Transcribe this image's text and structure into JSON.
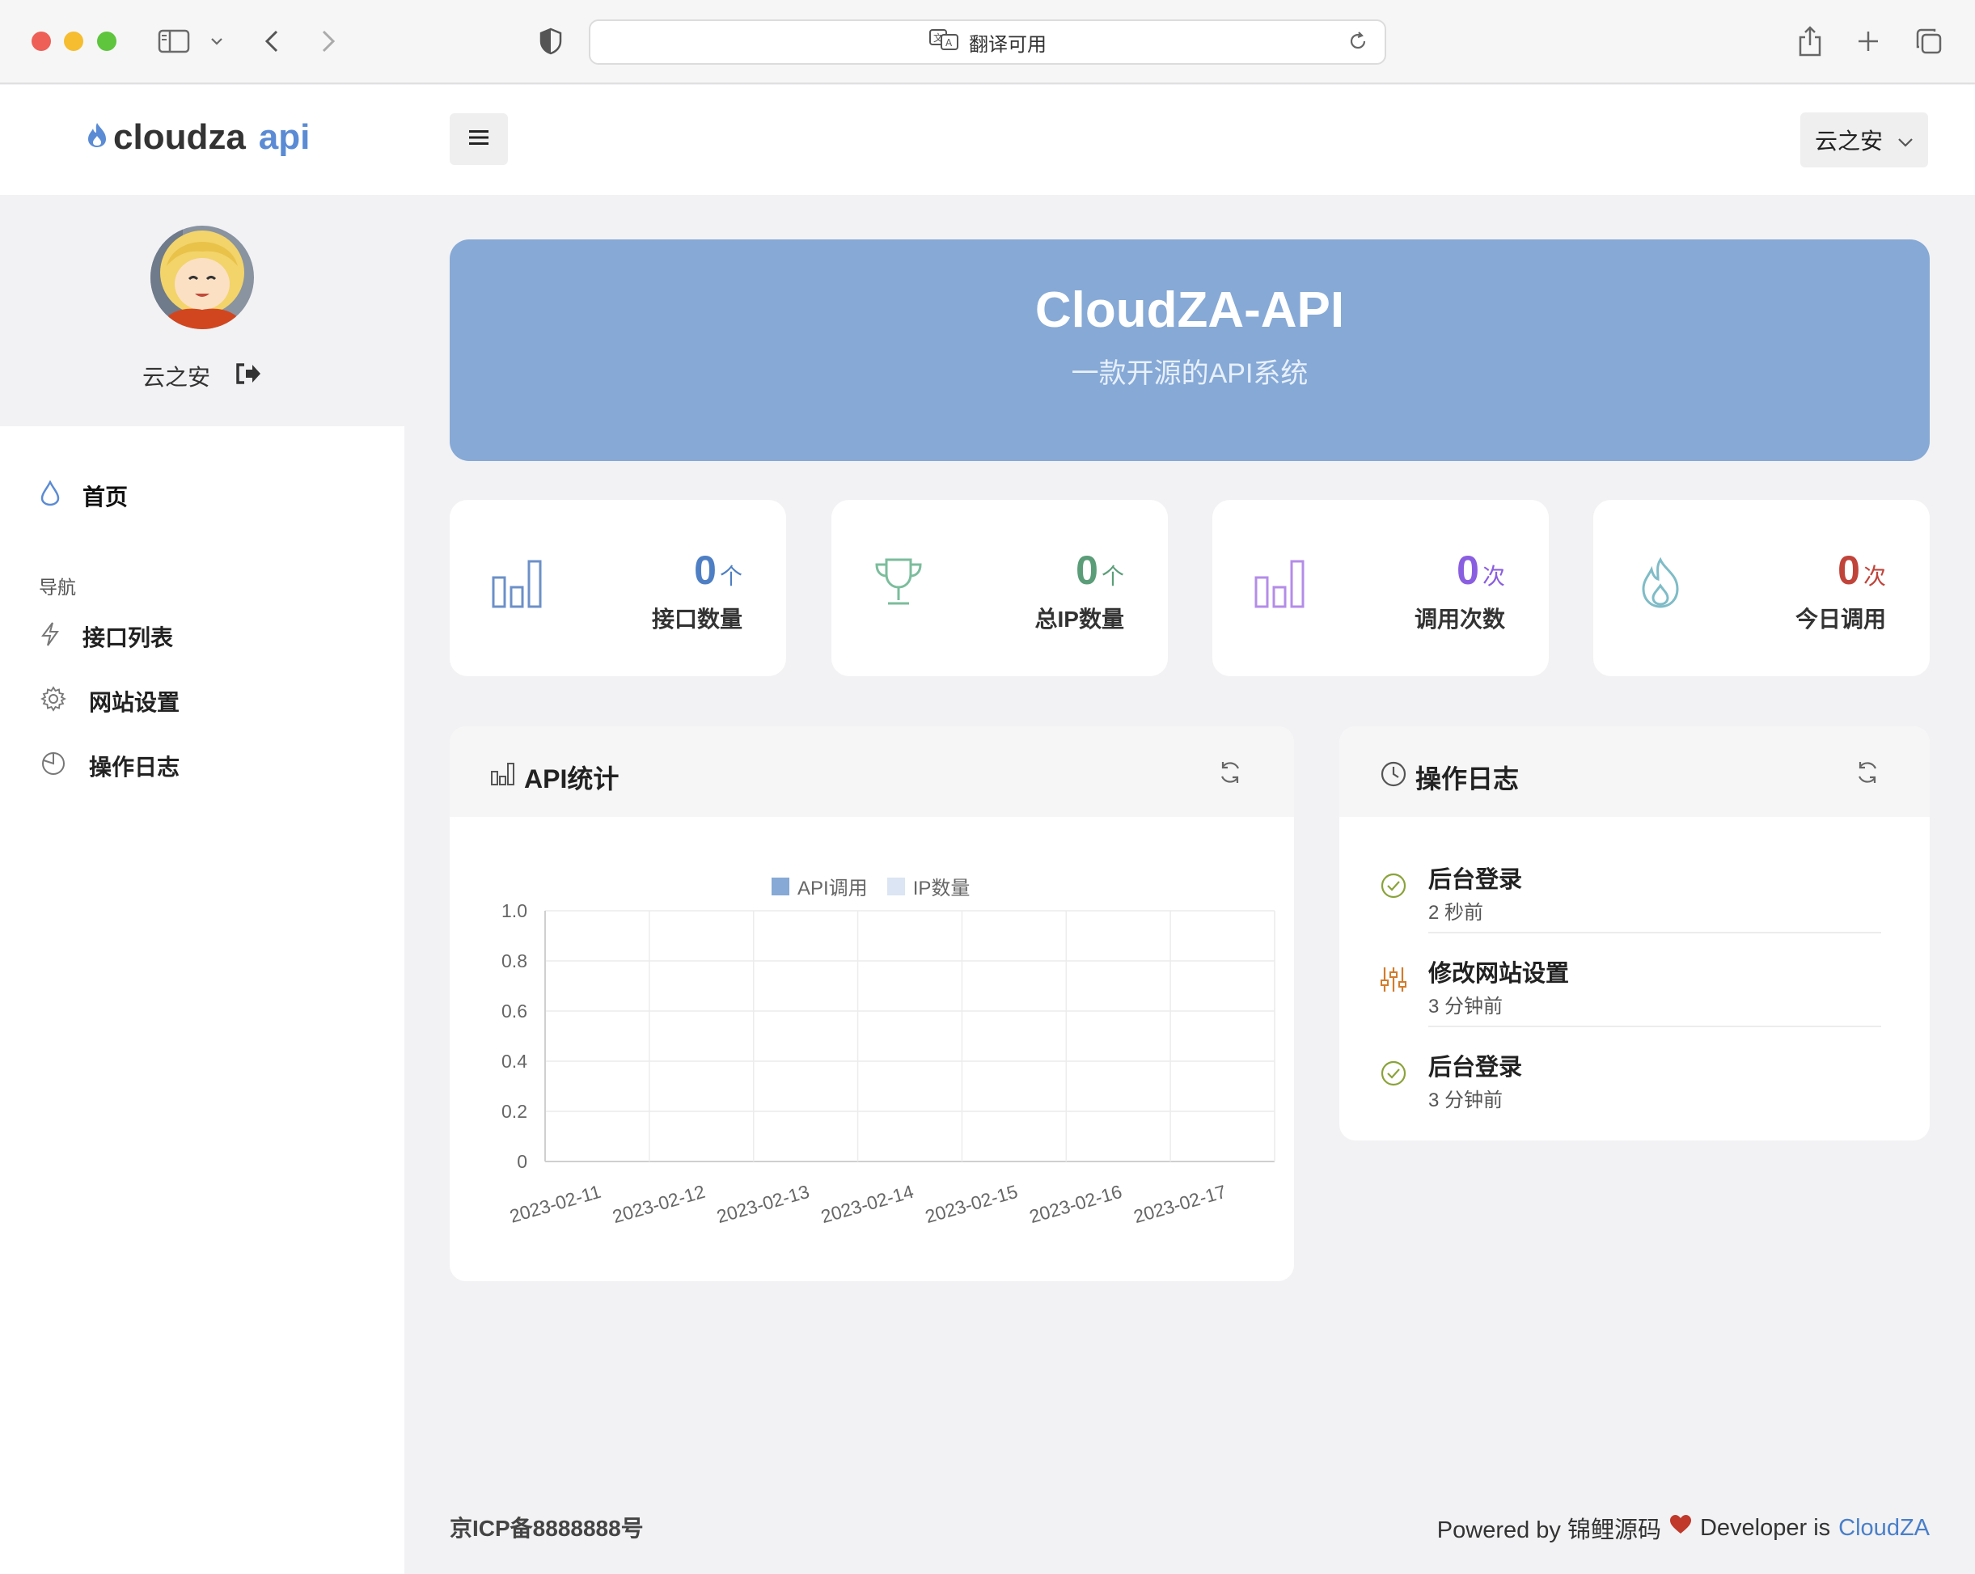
{
  "browser": {
    "address_text": "翻译可用"
  },
  "app": {
    "logo_main": "cloudza",
    "logo_accent": "api",
    "user_menu_label": "云之安"
  },
  "sidebar": {
    "username": "云之安",
    "home_label": "首页",
    "section_label": "导航",
    "items": [
      {
        "label": "接口列表",
        "icon": "bolt-icon"
      },
      {
        "label": "网站设置",
        "icon": "gear-icon"
      },
      {
        "label": "操作日志",
        "icon": "pie-icon"
      }
    ]
  },
  "banner": {
    "title": "CloudZA-API",
    "subtitle": "一款开源的API系统"
  },
  "stats": [
    {
      "value": "0",
      "unit": "个",
      "label": "接口数量",
      "color": "#4e7fc4",
      "icon": "bar-chart-icon"
    },
    {
      "value": "0",
      "unit": "个",
      "label": "总IP数量",
      "color": "#5a9d78",
      "icon": "trophy-icon"
    },
    {
      "value": "0",
      "unit": "次",
      "label": "调用次数",
      "color": "#8a5ee0",
      "icon": "bar-chart-icon"
    },
    {
      "value": "0",
      "unit": "次",
      "label": "今日调用",
      "color": "#c0443a",
      "icon": "fire-icon"
    }
  ],
  "api_card": {
    "title": "API统计"
  },
  "chart_data": {
    "type": "bar",
    "title": "",
    "categories": [
      "2023-02-11",
      "2023-02-12",
      "2023-02-13",
      "2023-02-14",
      "2023-02-15",
      "2023-02-16",
      "2023-02-17"
    ],
    "series": [
      {
        "name": "API调用",
        "values": [
          0,
          0,
          0,
          0,
          0,
          0,
          0
        ],
        "color": "#86a9d6"
      },
      {
        "name": "IP数量",
        "values": [
          0,
          0,
          0,
          0,
          0,
          0,
          0
        ],
        "color": "#dbe5f3"
      }
    ],
    "ylim": [
      0,
      1.0
    ],
    "yticks": [
      "0",
      "0.2",
      "0.4",
      "0.6",
      "0.8",
      "1.0"
    ],
    "grid": true,
    "legend": "top-center"
  },
  "log_card": {
    "title": "操作日志",
    "items": [
      {
        "title": "后台登录",
        "time": "2 秒前",
        "icon": "check-circle-icon"
      },
      {
        "title": "修改网站设置",
        "time": "3 分钟前",
        "icon": "sliders-icon"
      },
      {
        "title": "后台登录",
        "time": "3 分钟前",
        "icon": "check-circle-icon"
      }
    ]
  },
  "footer": {
    "icp": "京ICP备8888888号",
    "powered_prefix": "Powered by 锦鲤源码",
    "developer_prefix": "Developer is",
    "developer_link": "CloudZA"
  }
}
